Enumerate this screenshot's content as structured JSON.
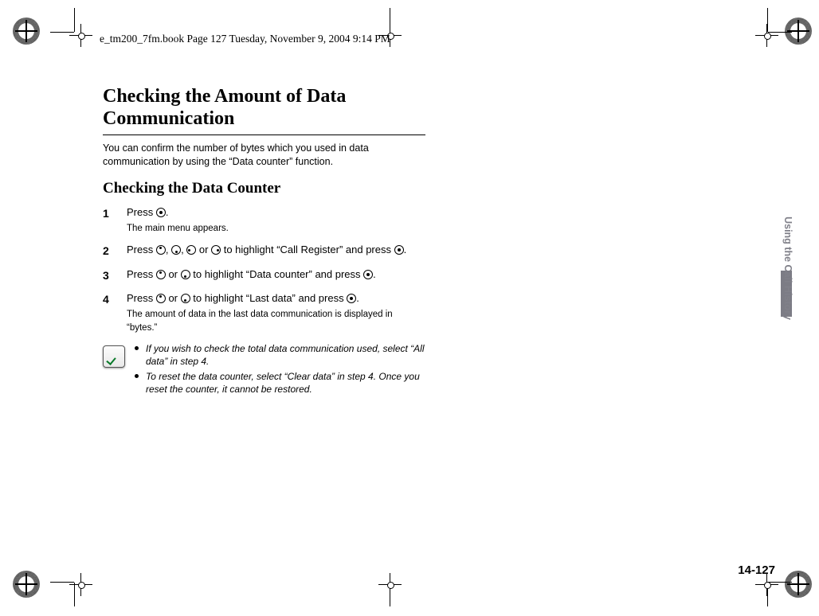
{
  "header": "e_tm200_7fm.book  Page 127  Tuesday, November 9, 2004  9:14 PM",
  "title": "Checking the Amount of Data Communication",
  "intro": "You can confirm the number of bytes which you used in data communication by using the “Data counter” function.",
  "subheading": "Checking the Data Counter",
  "steps": {
    "s1": {
      "num": "1",
      "a": "Press ",
      "b": ".",
      "sub": "The main menu appears."
    },
    "s2": {
      "num": "2",
      "a": "Press ",
      "b": ", ",
      "c": ", ",
      "d": " or ",
      "e": " to highlight “Call Register” and press ",
      "f": "."
    },
    "s3": {
      "num": "3",
      "a": "Press ",
      "b": " or ",
      "c": " to highlight “Data counter” and press ",
      "d": "."
    },
    "s4": {
      "num": "4",
      "a": "Press ",
      "b": " or ",
      "c": " to highlight “Last data” and press ",
      "d": ".",
      "sub": "The amount of data in the last data communication is displayed in “bytes.”"
    }
  },
  "notes": {
    "n1": "If you wish to check the total data communication used, select “All data” in step 4.",
    "n2": "To reset the data counter, select “Clear data” in step 4. Once you reset the counter, it cannot be restored."
  },
  "sideTab": "Using the Call History",
  "pageNum": "14-127"
}
